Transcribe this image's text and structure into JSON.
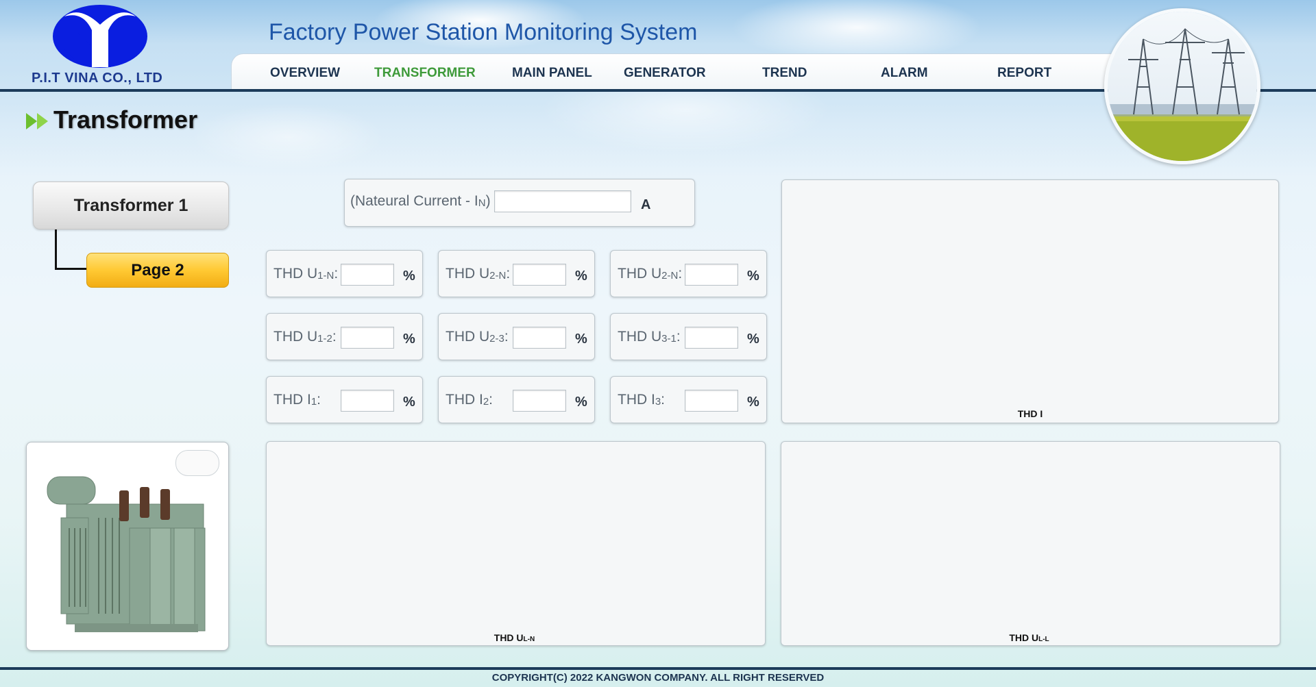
{
  "header": {
    "company": "P.I.T VINA CO., LTD",
    "app_title": "Factory Power Station Monitoring System",
    "nav": [
      {
        "label": "OVERVIEW",
        "active": false
      },
      {
        "label": "TRANSFORMER",
        "active": true
      },
      {
        "label": "MAIN PANEL",
        "active": false
      },
      {
        "label": "GENERATOR",
        "active": false
      },
      {
        "label": "TREND",
        "active": false
      },
      {
        "label": "ALARM",
        "active": false
      },
      {
        "label": "REPORT",
        "active": false
      }
    ]
  },
  "page": {
    "title": "Transformer"
  },
  "sidebar": {
    "tree_label": "Transformer 1",
    "page_label": "Page 2"
  },
  "neutral": {
    "label": "(Nateural Current - I",
    "sub": "N",
    "tail": ")",
    "value": "",
    "unit": "A"
  },
  "thd_fields": [
    {
      "label": "THD U",
      "sub": "1-N",
      "tail": ":",
      "value": "",
      "unit": "%"
    },
    {
      "label": "THD U",
      "sub": "2-N",
      "tail": ":",
      "value": "",
      "unit": "%"
    },
    {
      "label": "THD U",
      "sub": "2-N",
      "tail": ":",
      "value": "",
      "unit": "%"
    },
    {
      "label": "THD U",
      "sub": "1-2",
      "tail": ":",
      "value": "",
      "unit": "%"
    },
    {
      "label": "THD U",
      "sub": "2-3",
      "tail": ":",
      "value": "",
      "unit": "%"
    },
    {
      "label": "THD U",
      "sub": "3-1",
      "tail": ":",
      "value": "",
      "unit": "%"
    },
    {
      "label": "THD I",
      "sub": "1",
      "tail": ":",
      "value": "",
      "unit": "%"
    },
    {
      "label": "THD I",
      "sub": "2",
      "tail": ":",
      "value": "",
      "unit": "%"
    },
    {
      "label": "THD I",
      "sub": "3",
      "tail": ":",
      "value": "",
      "unit": "%"
    }
  ],
  "charts": {
    "thd_i": {
      "label": "THD I",
      "sub": ""
    },
    "thd_uln": {
      "label": "THD U",
      "sub": "L-N"
    },
    "thd_ull": {
      "label": "THD U",
      "sub": "L-L"
    }
  },
  "footer": {
    "copyright": "COPYRIGHT(C) 2022 KANGWON COMPANY. ALL RIGHT RESERVED"
  },
  "colors": {
    "accent_active": "#3e9a3a",
    "title_blue": "#1e56a8",
    "header_rule": "#1c3b5a",
    "page_button": "#ffc933"
  }
}
